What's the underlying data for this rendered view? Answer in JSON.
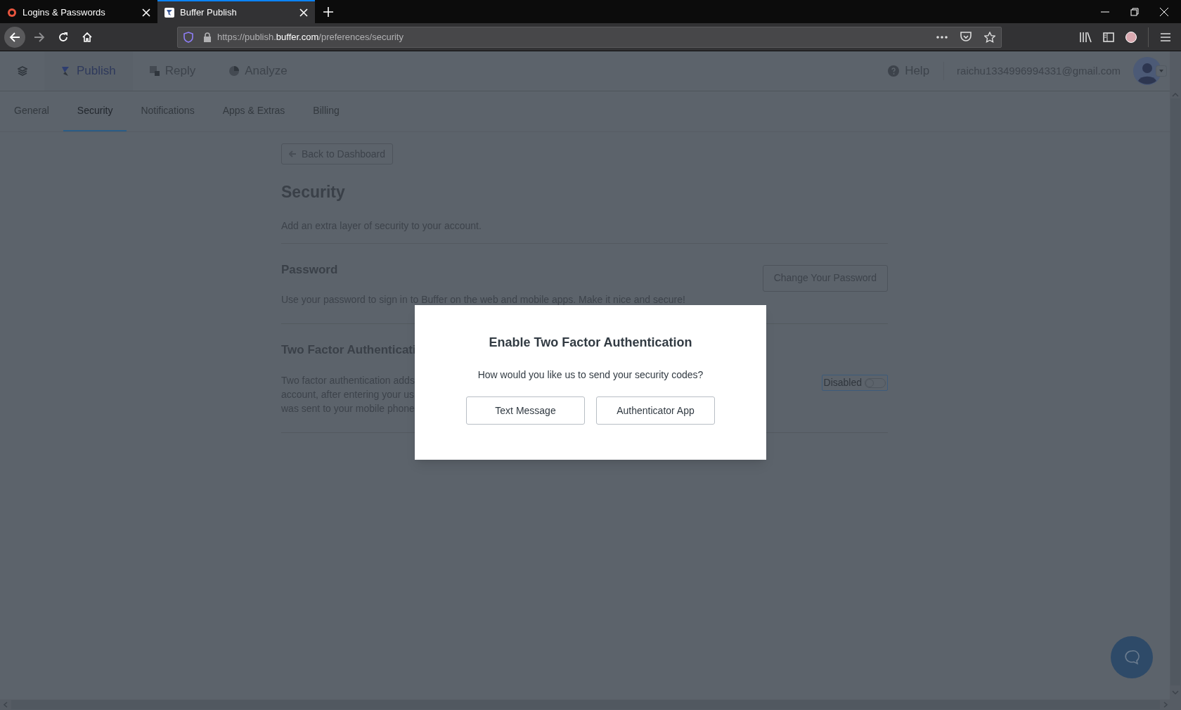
{
  "browser": {
    "tabs": [
      {
        "title": "Logins & Passwords",
        "selected": false
      },
      {
        "title": "Buffer Publish",
        "selected": true
      }
    ],
    "url": {
      "scheme": "https://publish.",
      "domain": "buffer.com",
      "path": "/preferences/security"
    }
  },
  "app_nav": {
    "items": [
      {
        "label": "Publish",
        "selected": true
      },
      {
        "label": "Reply",
        "selected": false
      },
      {
        "label": "Analyze",
        "selected": false
      }
    ],
    "help": "Help",
    "email": "raichu1334996994331@gmail.com"
  },
  "settings_tabs": [
    {
      "label": "General",
      "selected": false
    },
    {
      "label": "Security",
      "selected": true
    },
    {
      "label": "Notifications",
      "selected": false
    },
    {
      "label": "Apps & Extras",
      "selected": false
    },
    {
      "label": "Billing",
      "selected": false
    }
  ],
  "page": {
    "back_button": "Back to Dashboard",
    "title": "Security",
    "description": "Add an extra layer of security to your account.",
    "sections": [
      {
        "kind": "password",
        "heading": "Password",
        "description": "Use your password to sign in to Buffer on the web and mobile apps. Make it nice and secure!",
        "button": "Change Your Password"
      },
      {
        "kind": "two_factor",
        "heading": "Two Factor Authenticati",
        "description": "Two factor authentication adds\naccount, after entering your us\nwas sent to your mobile phone",
        "toggle": {
          "label": "Disabled",
          "on": false
        }
      }
    ]
  },
  "modal": {
    "title": "Enable Two Factor Authentication",
    "question": "How would you like us to send your security codes?",
    "buttons": [
      "Text Message",
      "Authenticator App"
    ]
  }
}
